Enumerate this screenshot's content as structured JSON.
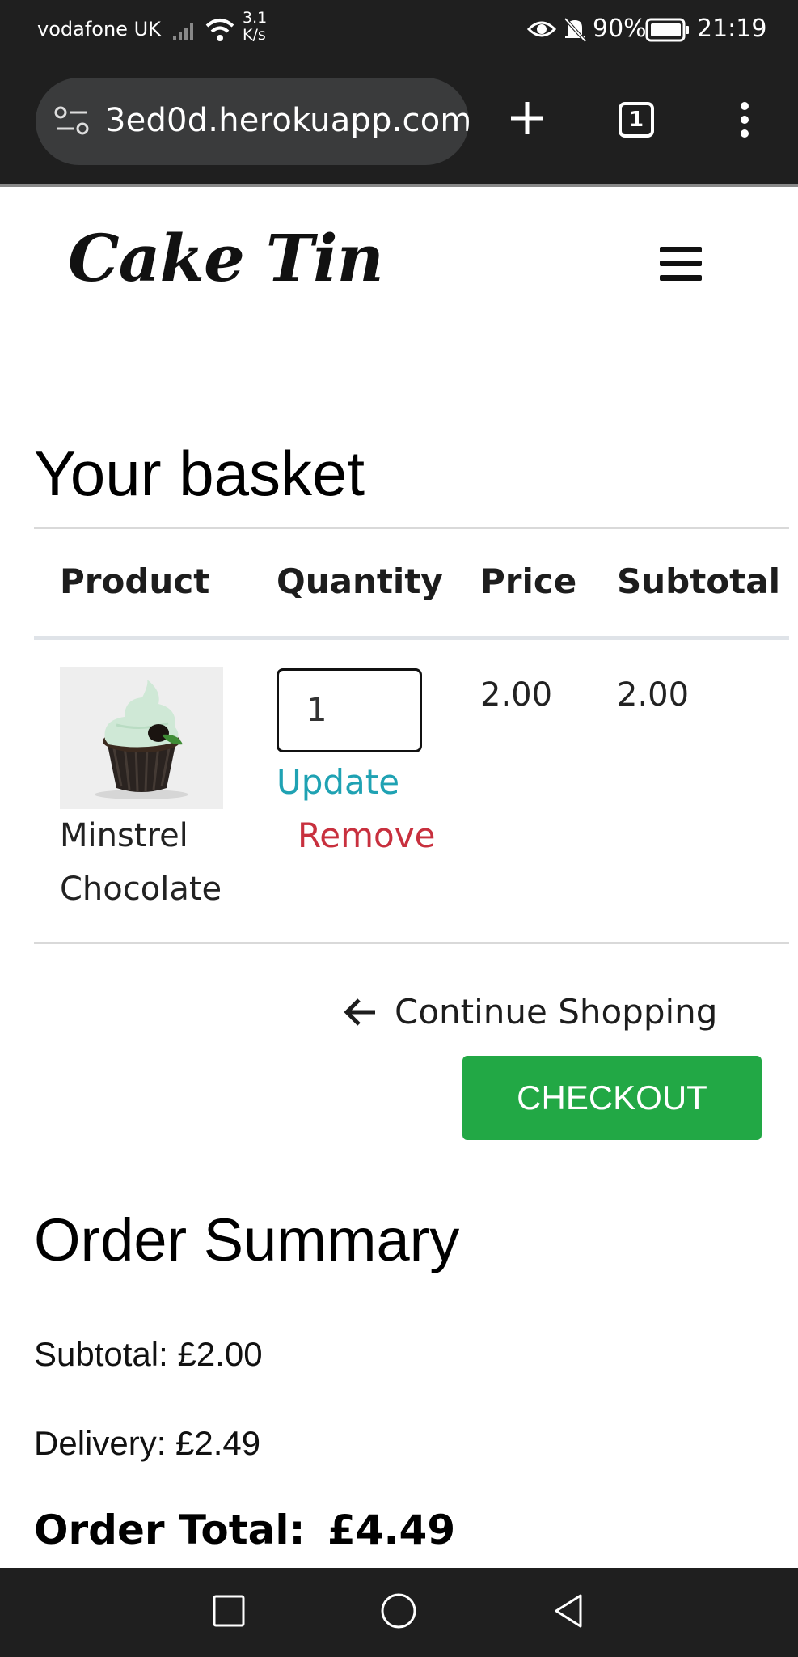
{
  "status_bar": {
    "carrier": "vodafone UK",
    "speed_value": "3.1",
    "speed_unit": "K/s",
    "battery": "90%",
    "time": "21:19"
  },
  "browser": {
    "url": "3ed0d.herokuapp.com",
    "tab_count": "1"
  },
  "site": {
    "logo": "Cake Tin"
  },
  "basket": {
    "title": "Your basket",
    "columns": [
      "Product",
      "Quantity",
      "Price",
      "Subtotal"
    ],
    "items": [
      {
        "name_line1": "Minstrel",
        "name_line2": "Chocolate",
        "quantity": "1",
        "price": "2.00",
        "subtotal": "2.00",
        "update_label": "Update",
        "remove_label": "Remove"
      }
    ],
    "continue_label": "Continue Shopping",
    "checkout_label": "CHECKOUT"
  },
  "summary": {
    "title": "Order Summary",
    "subtotal": "Subtotal: £2.00",
    "delivery": "Delivery: £2.49",
    "total_label": "Order Total:",
    "total_value": "£4.49"
  },
  "colors": {
    "update_link": "#1fa2b3",
    "remove_link": "#c8303e",
    "checkout_bg": "#22a845",
    "chrome_bg": "#1f1f1f"
  }
}
